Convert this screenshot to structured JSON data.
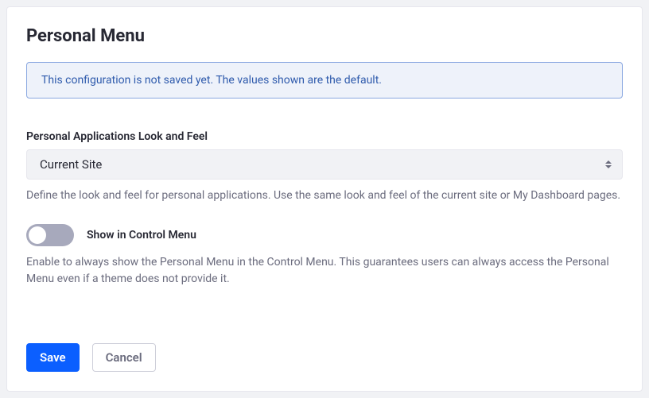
{
  "header": {
    "title": "Personal Menu"
  },
  "alert": {
    "message": "This configuration is not saved yet. The values shown are the default."
  },
  "fields": {
    "lookAndFeel": {
      "label": "Personal Applications Look and Feel",
      "selected": "Current Site",
      "help": "Define the look and feel for personal applications. Use the same look and feel of the current site or My Dashboard pages."
    },
    "showControl": {
      "label": "Show in Control Menu",
      "help": "Enable to always show the Personal Menu in the Control Menu. This guarantees users can always access the Personal Menu even if a theme does not provide it."
    }
  },
  "buttons": {
    "save": "Save",
    "cancel": "Cancel"
  }
}
